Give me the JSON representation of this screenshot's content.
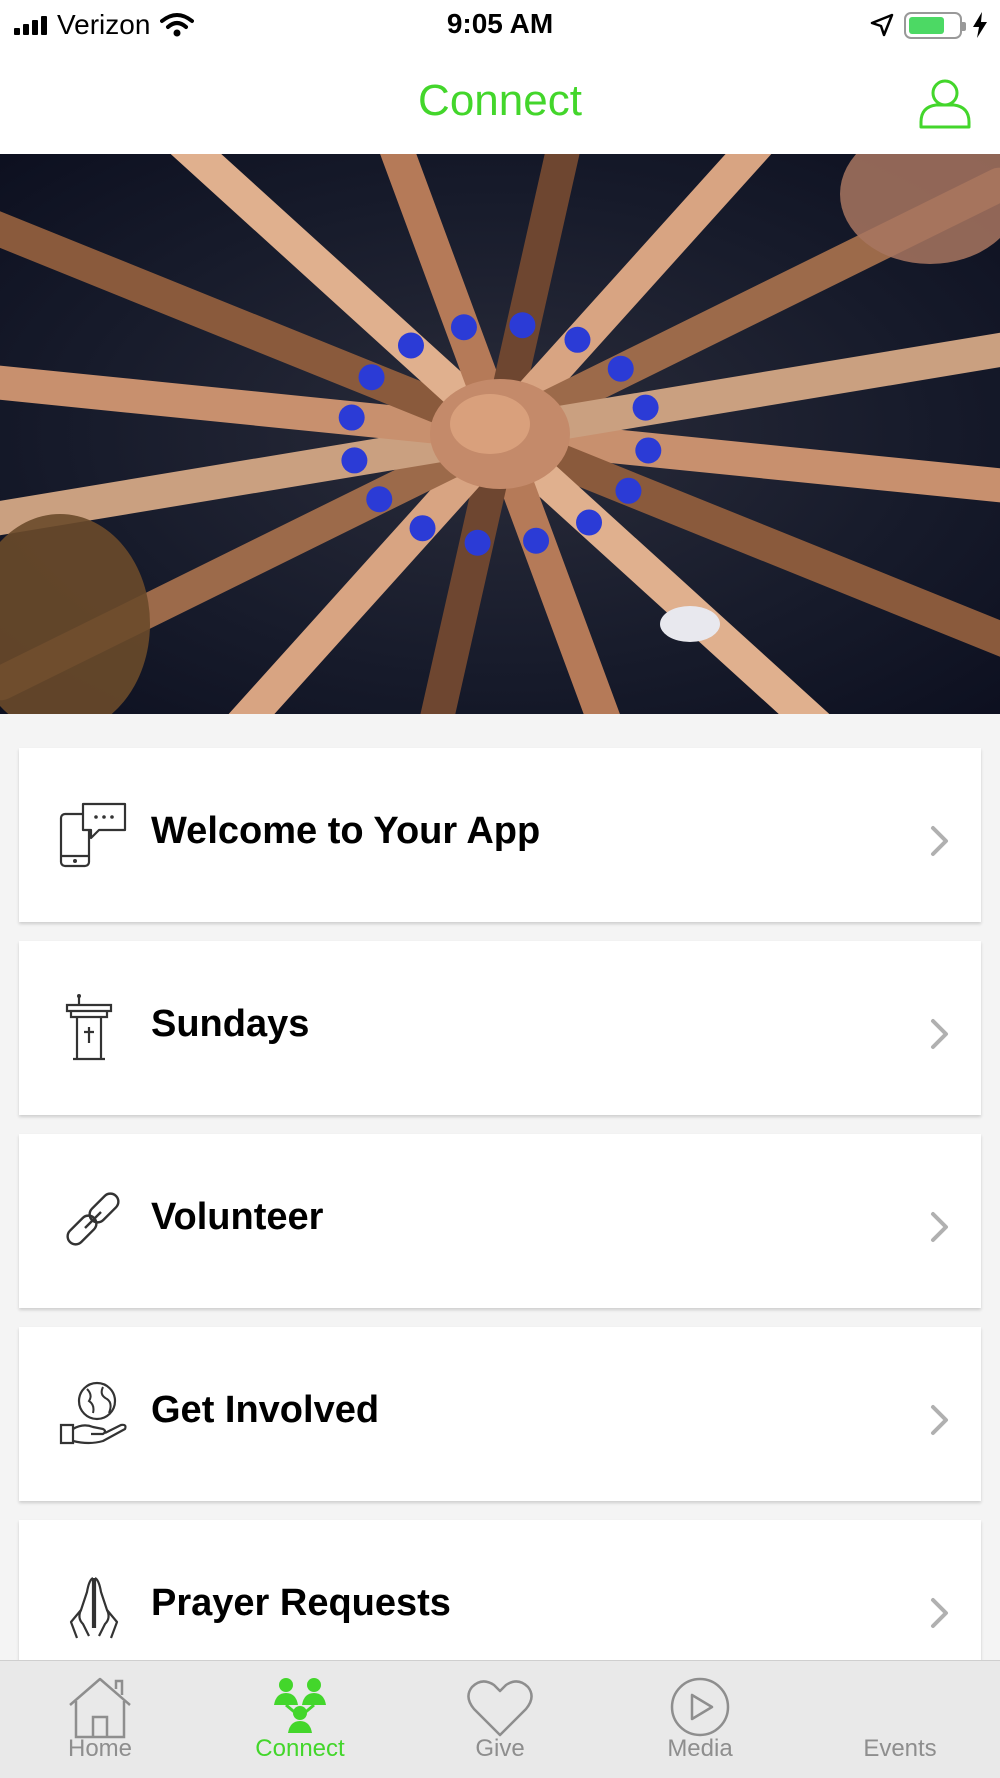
{
  "status_bar": {
    "carrier": "Verizon",
    "time": "9:05 AM",
    "battery_level": 0.72
  },
  "nav": {
    "title": "Connect",
    "profile_icon": "person-outline-icon"
  },
  "hero": {
    "description_icon": "hands-together-photo"
  },
  "menu": {
    "items": [
      {
        "label": "Welcome to Your App",
        "icon": "phone-chat-icon"
      },
      {
        "label": "Sundays",
        "icon": "pulpit-icon"
      },
      {
        "label": "Volunteer",
        "icon": "link-icon"
      },
      {
        "label": "Get Involved",
        "icon": "globe-hand-icon"
      },
      {
        "label": "Prayer Requests",
        "icon": "praying-hands-icon"
      }
    ]
  },
  "tab_bar": {
    "active": "Connect",
    "tabs": [
      {
        "label": "Home",
        "icon": "home-icon"
      },
      {
        "label": "Connect",
        "icon": "people-icon"
      },
      {
        "label": "Give",
        "icon": "heart-icon"
      },
      {
        "label": "Media",
        "icon": "play-circle-icon"
      },
      {
        "label": "Events",
        "icon": "calendar-icon"
      }
    ]
  },
  "colors": {
    "accent": "#43d62b",
    "tab_inactive": "#8e8e8e",
    "background": "#f4f4f4"
  }
}
